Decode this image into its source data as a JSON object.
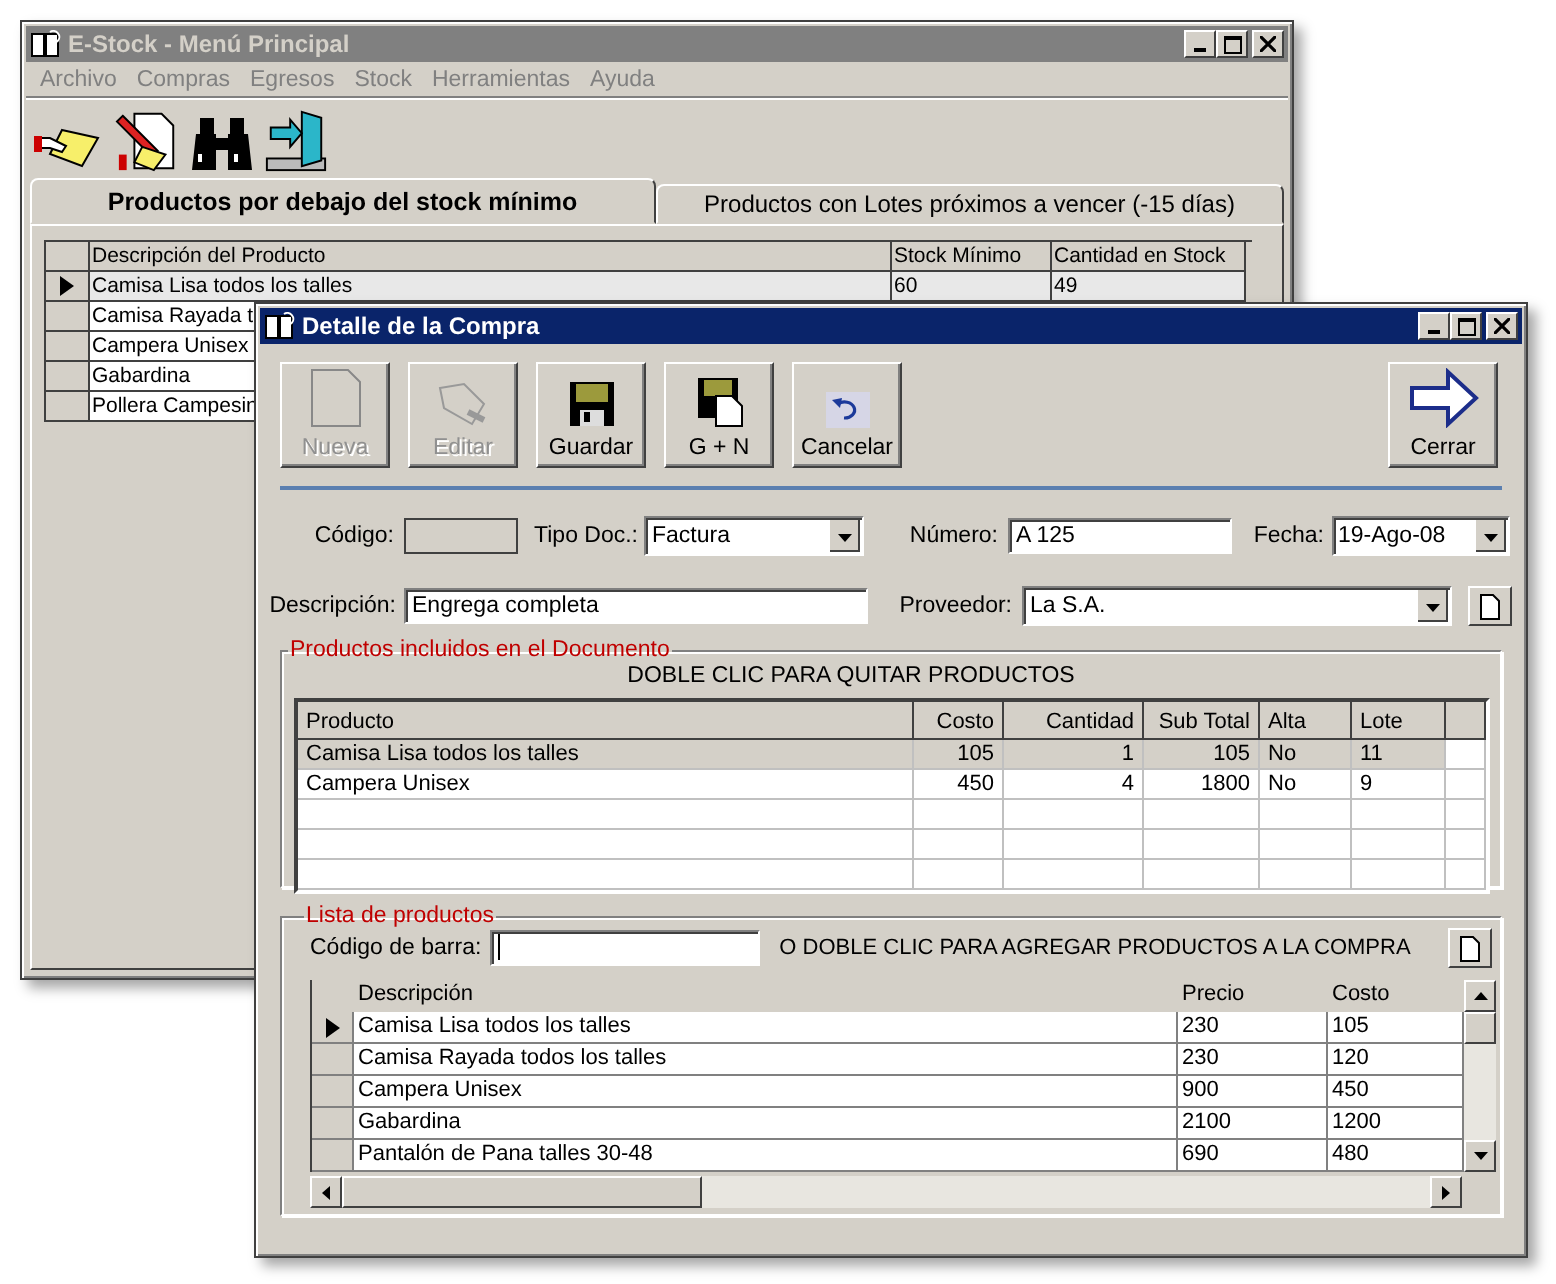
{
  "main_window": {
    "title": "E-Stock - Menú Principal",
    "active": false,
    "menu": [
      "Archivo",
      "Compras",
      "Egresos",
      "Stock",
      "Herramientas",
      "Ayuda"
    ],
    "tabs": [
      {
        "label": "Productos por debajo del stock mínimo",
        "selected": true
      },
      {
        "label": "Productos con Lotes próximos a vencer (-15 días)",
        "selected": false
      }
    ],
    "table": {
      "columns": [
        "Descripción del Producto",
        "Stock Mínimo",
        "Cantidad en Stock"
      ],
      "rows": [
        {
          "cells": [
            "Camisa Lisa todos los talles",
            "60",
            "49"
          ],
          "selected": true
        },
        {
          "cells": [
            "Camisa Rayada t"
          ],
          "selected": false
        },
        {
          "cells": [
            "Campera Unisex"
          ],
          "selected": false
        },
        {
          "cells": [
            "Gabardina"
          ],
          "selected": false
        },
        {
          "cells": [
            "Pollera Campesin"
          ],
          "selected": false
        }
      ]
    }
  },
  "detail_window": {
    "title": "Detalle de la Compra",
    "active": true,
    "buttons": [
      {
        "kind": "new",
        "label": "Nueva",
        "disabled": true
      },
      {
        "kind": "edit",
        "label": "Editar",
        "disabled": true
      },
      {
        "kind": "save",
        "label": "Guardar",
        "disabled": false
      },
      {
        "kind": "save_new",
        "label": "G + N",
        "disabled": false
      },
      {
        "kind": "cancel",
        "label": "Cancelar",
        "disabled": false
      },
      {
        "kind": "close",
        "label": "Cerrar",
        "disabled": false
      }
    ],
    "codigo": {
      "label": "Código:"
    },
    "tipo_doc": {
      "label": "Tipo Doc.:",
      "value": "Factura"
    },
    "numero": {
      "label": "Número:",
      "value": "A 125"
    },
    "fecha": {
      "label": "Fecha:",
      "value": "19-Ago-08"
    },
    "descripcion": {
      "label": "Descripción:",
      "value": "Engrega completa"
    },
    "proveedor": {
      "label": "Proveedor:",
      "value": "La S.A."
    },
    "included": {
      "title": "Productos incluidos en el Documento",
      "hint": "DOBLE CLIC PARA QUITAR PRODUCTOS",
      "columns": [
        "Producto",
        "Costo",
        "Cantidad",
        "Sub Total",
        "Alta",
        "Lote"
      ],
      "rows": [
        {
          "cells": [
            "Camisa Lisa todos los talles",
            "105",
            "1",
            "105",
            "No",
            "11"
          ],
          "selected": true
        },
        {
          "cells": [
            "Campera Unisex",
            "450",
            "4",
            "1800",
            "No",
            "9"
          ],
          "selected": false
        }
      ]
    },
    "product_list": {
      "title": "Lista de productos",
      "barcode_label": "Código de barra:",
      "hint": "O DOBLE CLIC PARA AGREGAR PRODUCTOS A LA COMPRA",
      "columns": [
        "Descripción",
        "Precio",
        "Costo"
      ],
      "rows": [
        {
          "cells": [
            "Camisa Lisa todos los talles",
            "230",
            "105"
          ],
          "selected": true
        },
        {
          "cells": [
            "Camisa Rayada todos los talles",
            "230",
            "120"
          ],
          "selected": false
        },
        {
          "cells": [
            "Campera Unisex",
            "900",
            "450"
          ],
          "selected": false
        },
        {
          "cells": [
            "Gabardina",
            "2100",
            "1200"
          ],
          "selected": false
        },
        {
          "cells": [
            "Pantalón de Pana talles 30-48",
            "690",
            "480"
          ],
          "selected": false
        }
      ]
    }
  }
}
